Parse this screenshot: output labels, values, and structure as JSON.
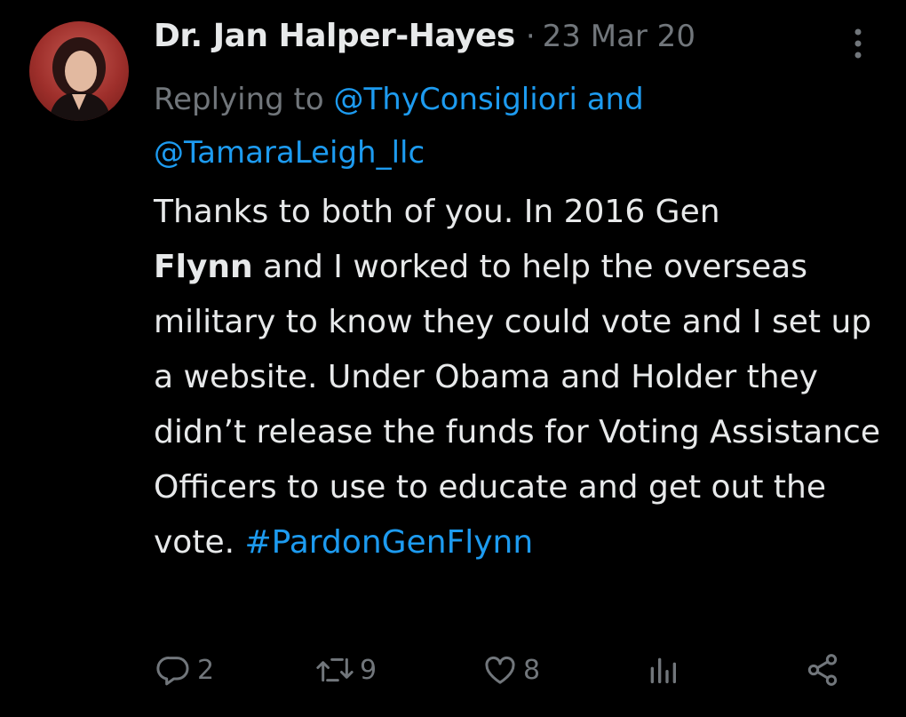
{
  "tweet": {
    "author_name": "Dr. Jan Halper-Hayes",
    "separator": "·",
    "date": "23 Mar 20",
    "reply_prefix": "Replying to ",
    "reply_user_1": "@ThyConsigliori",
    "reply_and": " and",
    "reply_user_2": "@TamaraLeigh_llc",
    "body_part1": "Thanks to both of you. In 2016 Gen",
    "body_bold": "Flynn",
    "body_part2": " and I worked to help the overseas military to know they could vote and I set up a website. Under Obama and Holder they didn’t release the funds for Voting Assistance Officers to use to educate and get out the vote. ",
    "hashtag": "#PardonGenFlynn"
  },
  "actions": {
    "replies": "2",
    "retweets": "9",
    "likes": "8"
  },
  "icons": [
    "more-options-icon",
    "reply-icon",
    "retweet-icon",
    "like-icon",
    "analytics-icon",
    "share-icon"
  ],
  "colors": {
    "background": "#000000",
    "text": "#e7e9ea",
    "muted": "#71767b",
    "link": "#1d9bf0"
  }
}
